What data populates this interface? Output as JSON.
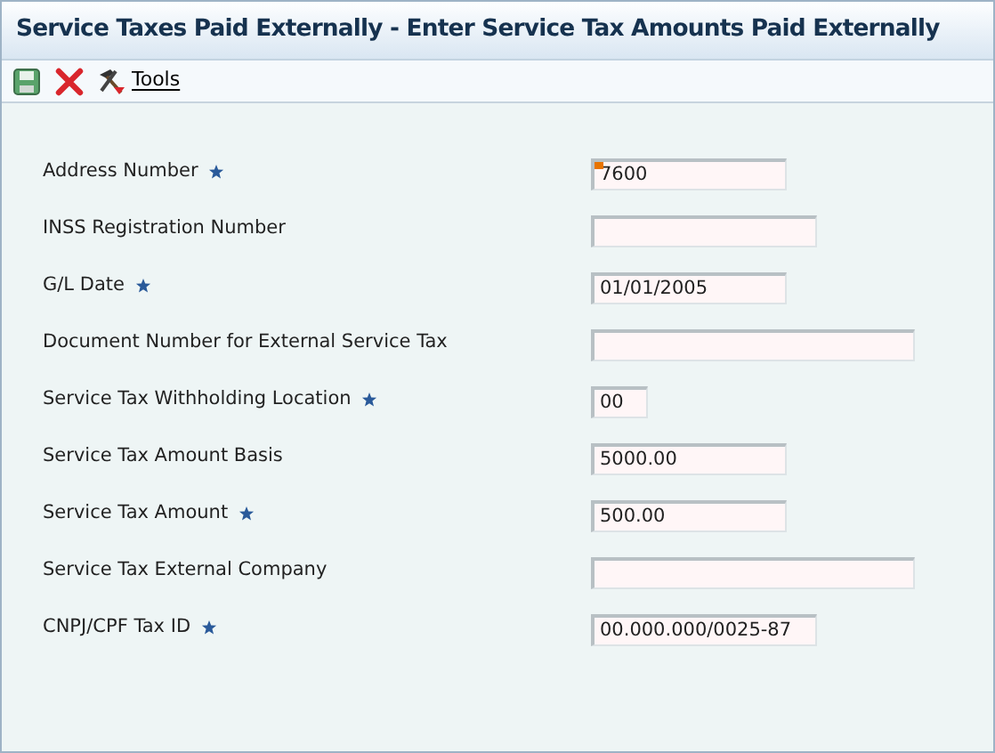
{
  "window": {
    "title": "Service Taxes Paid Externally - Enter Service Tax Amounts Paid Externally"
  },
  "toolbar": {
    "tools_label": "Tools"
  },
  "fields": [
    {
      "label": "Address Number",
      "required": true,
      "value": "7600",
      "flagged": true
    },
    {
      "label": "INSS Registration Number",
      "required": false,
      "flagged": false
    },
    {
      "label": "G/L Date",
      "required": true,
      "value": "01/01/2005",
      "flagged": false
    },
    {
      "label": "Document Number for External Service Tax",
      "required": false,
      "flagged": false
    },
    {
      "label": "Service Tax Withholding Location",
      "required": true,
      "value": "00",
      "flagged": false
    },
    {
      "label": "Service Tax Amount Basis",
      "required": false,
      "value": "5000.00",
      "flagged": false
    },
    {
      "label": "Service Tax Amount",
      "required": true,
      "value": "500.00",
      "flagged": false
    },
    {
      "label": "Service Tax External Company",
      "required": false,
      "flagged": false
    },
    {
      "label": "CNPJ/CPF Tax ID",
      "required": true,
      "value": "00.000.000/0025-87",
      "flagged": false
    }
  ]
}
